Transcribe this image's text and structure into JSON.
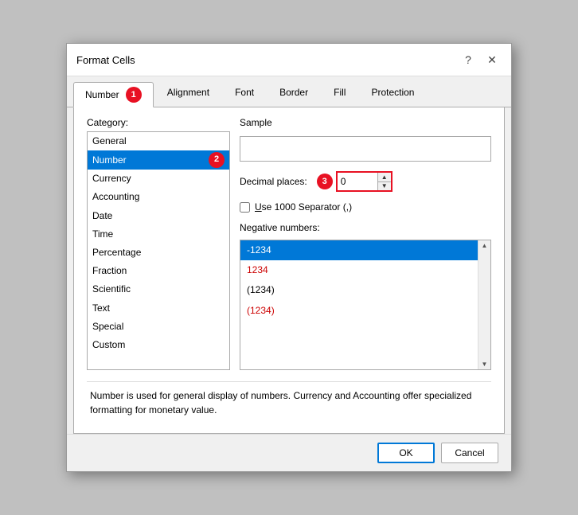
{
  "dialog": {
    "title": "Format Cells",
    "help_icon": "?",
    "close_icon": "✕"
  },
  "tabs": [
    {
      "id": "number",
      "label": "Number",
      "active": true
    },
    {
      "id": "alignment",
      "label": "Alignment",
      "active": false
    },
    {
      "id": "font",
      "label": "Font",
      "active": false
    },
    {
      "id": "border",
      "label": "Border",
      "active": false
    },
    {
      "id": "fill",
      "label": "Fill",
      "active": false
    },
    {
      "id": "protection",
      "label": "Protection",
      "active": false
    }
  ],
  "category": {
    "label": "Category:",
    "items": [
      {
        "id": "general",
        "label": "General",
        "selected": false
      },
      {
        "id": "number",
        "label": "Number",
        "selected": true
      },
      {
        "id": "currency",
        "label": "Currency",
        "selected": false
      },
      {
        "id": "accounting",
        "label": "Accounting",
        "selected": false
      },
      {
        "id": "date",
        "label": "Date",
        "selected": false
      },
      {
        "id": "time",
        "label": "Time",
        "selected": false
      },
      {
        "id": "percentage",
        "label": "Percentage",
        "selected": false
      },
      {
        "id": "fraction",
        "label": "Fraction",
        "selected": false
      },
      {
        "id": "scientific",
        "label": "Scientific",
        "selected": false
      },
      {
        "id": "text",
        "label": "Text",
        "selected": false
      },
      {
        "id": "special",
        "label": "Special",
        "selected": false
      },
      {
        "id": "custom",
        "label": "Custom",
        "selected": false
      }
    ]
  },
  "sample": {
    "label": "Sample",
    "value": ""
  },
  "decimal_places": {
    "label": "Decimal places:",
    "value": "0"
  },
  "separator": {
    "label": "Use 1000 Separator (,)",
    "checked": false
  },
  "negative_numbers": {
    "label": "Negative numbers:",
    "items": [
      {
        "id": "neg1",
        "label": "-1234",
        "selected": true,
        "red": false
      },
      {
        "id": "neg2",
        "label": "1234",
        "selected": false,
        "red": true
      },
      {
        "id": "neg3",
        "label": "(1234)",
        "selected": false,
        "red": false
      },
      {
        "id": "neg4",
        "label": "(1234)",
        "selected": false,
        "red": true
      }
    ]
  },
  "description": "Number is used for general display of numbers.  Currency and Accounting offer specialized formatting for monetary value.",
  "footer": {
    "ok_label": "OK",
    "cancel_label": "Cancel"
  },
  "badges": {
    "number_tab": "1",
    "number_category": "2",
    "decimal_section": "3"
  }
}
